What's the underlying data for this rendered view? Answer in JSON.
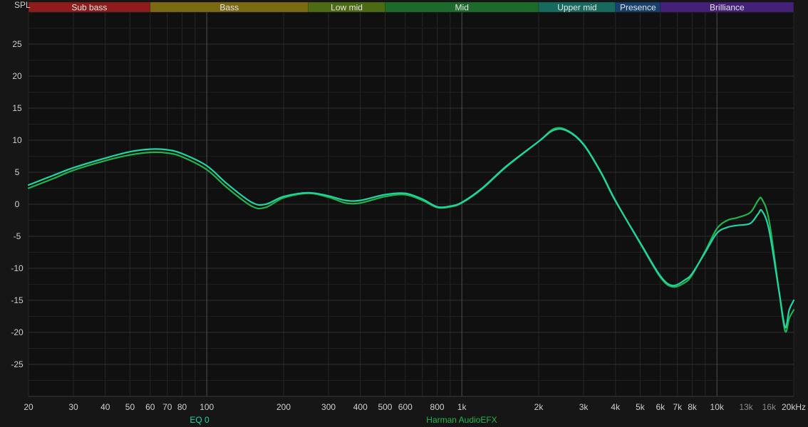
{
  "chart_data": {
    "type": "line",
    "ylabel": "SPL",
    "x_scale": "log",
    "xlim": [
      20,
      20000
    ],
    "ylim": [
      -30,
      30
    ],
    "grid": true,
    "bands": [
      {
        "label": "Sub bass",
        "from": 20,
        "to": 60,
        "color": "#8e1c1c"
      },
      {
        "label": "Bass",
        "from": 60,
        "to": 250,
        "color": "#7a6a12"
      },
      {
        "label": "Low mid",
        "from": 250,
        "to": 500,
        "color": "#4d6b12"
      },
      {
        "label": "Mid",
        "from": 500,
        "to": 2000,
        "color": "#1d6b2a"
      },
      {
        "label": "Upper mid",
        "from": 2000,
        "to": 4000,
        "color": "#166a5e"
      },
      {
        "label": "Presence",
        "from": 4000,
        "to": 6000,
        "color": "#16406e"
      },
      {
        "label": "Brilliance",
        "from": 6000,
        "to": 20000,
        "color": "#45207a"
      }
    ],
    "x_ticks": [
      {
        "value": 20,
        "label": "20"
      },
      {
        "value": 30,
        "label": "30"
      },
      {
        "value": 40,
        "label": "40"
      },
      {
        "value": 50,
        "label": "50"
      },
      {
        "value": 60,
        "label": "60"
      },
      {
        "value": 70,
        "label": "70"
      },
      {
        "value": 80,
        "label": "80"
      },
      {
        "value": 100,
        "label": "100"
      },
      {
        "value": 200,
        "label": "200"
      },
      {
        "value": 300,
        "label": "300"
      },
      {
        "value": 400,
        "label": "400"
      },
      {
        "value": 500,
        "label": "500"
      },
      {
        "value": 600,
        "label": "600"
      },
      {
        "value": 800,
        "label": "800"
      },
      {
        "value": 1000,
        "label": "1k"
      },
      {
        "value": 2000,
        "label": "2k"
      },
      {
        "value": 3000,
        "label": "3k"
      },
      {
        "value": 4000,
        "label": "4k"
      },
      {
        "value": 5000,
        "label": "5k"
      },
      {
        "value": 6000,
        "label": "6k"
      },
      {
        "value": 7000,
        "label": "7k"
      },
      {
        "value": 8000,
        "label": "8k"
      },
      {
        "value": 10000,
        "label": "10k"
      },
      {
        "value": 13000,
        "label": "13k",
        "dim": true
      },
      {
        "value": 16000,
        "label": "16k",
        "dim": true
      },
      {
        "value": 20000,
        "label": "20kHz"
      }
    ],
    "y_ticks": [
      25,
      20,
      15,
      10,
      5,
      0,
      -5,
      -10,
      -15,
      -20,
      -25
    ],
    "series": [
      {
        "name": "EQ 0",
        "color": "#1fd6a6",
        "points": [
          [
            20,
            3.0
          ],
          [
            25,
            4.5
          ],
          [
            30,
            5.7
          ],
          [
            40,
            7.2
          ],
          [
            50,
            8.2
          ],
          [
            60,
            8.6
          ],
          [
            70,
            8.5
          ],
          [
            80,
            7.9
          ],
          [
            100,
            6.0
          ],
          [
            120,
            3.2
          ],
          [
            150,
            0.3
          ],
          [
            170,
            0.0
          ],
          [
            200,
            1.2
          ],
          [
            250,
            1.8
          ],
          [
            300,
            1.3
          ],
          [
            350,
            0.6
          ],
          [
            400,
            0.6
          ],
          [
            500,
            1.5
          ],
          [
            600,
            1.7
          ],
          [
            700,
            0.8
          ],
          [
            800,
            -0.4
          ],
          [
            900,
            -0.3
          ],
          [
            1000,
            0.3
          ],
          [
            1200,
            2.5
          ],
          [
            1500,
            6.0
          ],
          [
            2000,
            9.8
          ],
          [
            2300,
            11.6
          ],
          [
            2600,
            11.4
          ],
          [
            3000,
            9.3
          ],
          [
            3500,
            5.0
          ],
          [
            4000,
            0.5
          ],
          [
            5000,
            -6.0
          ],
          [
            6000,
            -11.2
          ],
          [
            6700,
            -12.7
          ],
          [
            7500,
            -11.8
          ],
          [
            8000,
            -10.8
          ],
          [
            9000,
            -7.5
          ],
          [
            10000,
            -4.5
          ],
          [
            11000,
            -3.6
          ],
          [
            12000,
            -3.3
          ],
          [
            13500,
            -3.0
          ],
          [
            14500,
            -1.5
          ],
          [
            15000,
            -1.0
          ],
          [
            16000,
            -4.0
          ],
          [
            17500,
            -13.5
          ],
          [
            18500,
            -19.2
          ],
          [
            19200,
            -16.5
          ],
          [
            20000,
            -15.0
          ]
        ]
      },
      {
        "name": "Harman AudioEFX",
        "color": "#22b34a",
        "points": [
          [
            20,
            2.5
          ],
          [
            25,
            4.0
          ],
          [
            30,
            5.3
          ],
          [
            40,
            6.8
          ],
          [
            50,
            7.7
          ],
          [
            60,
            8.1
          ],
          [
            70,
            8.0
          ],
          [
            80,
            7.4
          ],
          [
            100,
            5.4
          ],
          [
            120,
            2.6
          ],
          [
            150,
            -0.3
          ],
          [
            170,
            -0.5
          ],
          [
            200,
            1.0
          ],
          [
            250,
            1.7
          ],
          [
            300,
            1.1
          ],
          [
            350,
            0.2
          ],
          [
            400,
            0.2
          ],
          [
            500,
            1.2
          ],
          [
            600,
            1.5
          ],
          [
            700,
            0.6
          ],
          [
            800,
            -0.5
          ],
          [
            900,
            -0.4
          ],
          [
            1000,
            0.2
          ],
          [
            1200,
            2.4
          ],
          [
            1500,
            5.9
          ],
          [
            2000,
            9.8
          ],
          [
            2300,
            11.8
          ],
          [
            2600,
            11.5
          ],
          [
            3000,
            9.4
          ],
          [
            3500,
            5.1
          ],
          [
            4000,
            0.6
          ],
          [
            5000,
            -6.1
          ],
          [
            6000,
            -11.4
          ],
          [
            6700,
            -12.9
          ],
          [
            7500,
            -12.2
          ],
          [
            8000,
            -11.0
          ],
          [
            9000,
            -7.3
          ],
          [
            10000,
            -3.8
          ],
          [
            11000,
            -2.5
          ],
          [
            12000,
            -2.1
          ],
          [
            13500,
            -1.3
          ],
          [
            14500,
            0.6
          ],
          [
            15000,
            0.8
          ],
          [
            16000,
            -2.5
          ],
          [
            17500,
            -13.5
          ],
          [
            18500,
            -19.8
          ],
          [
            19200,
            -17.8
          ],
          [
            20000,
            -16.5
          ]
        ]
      }
    ]
  }
}
